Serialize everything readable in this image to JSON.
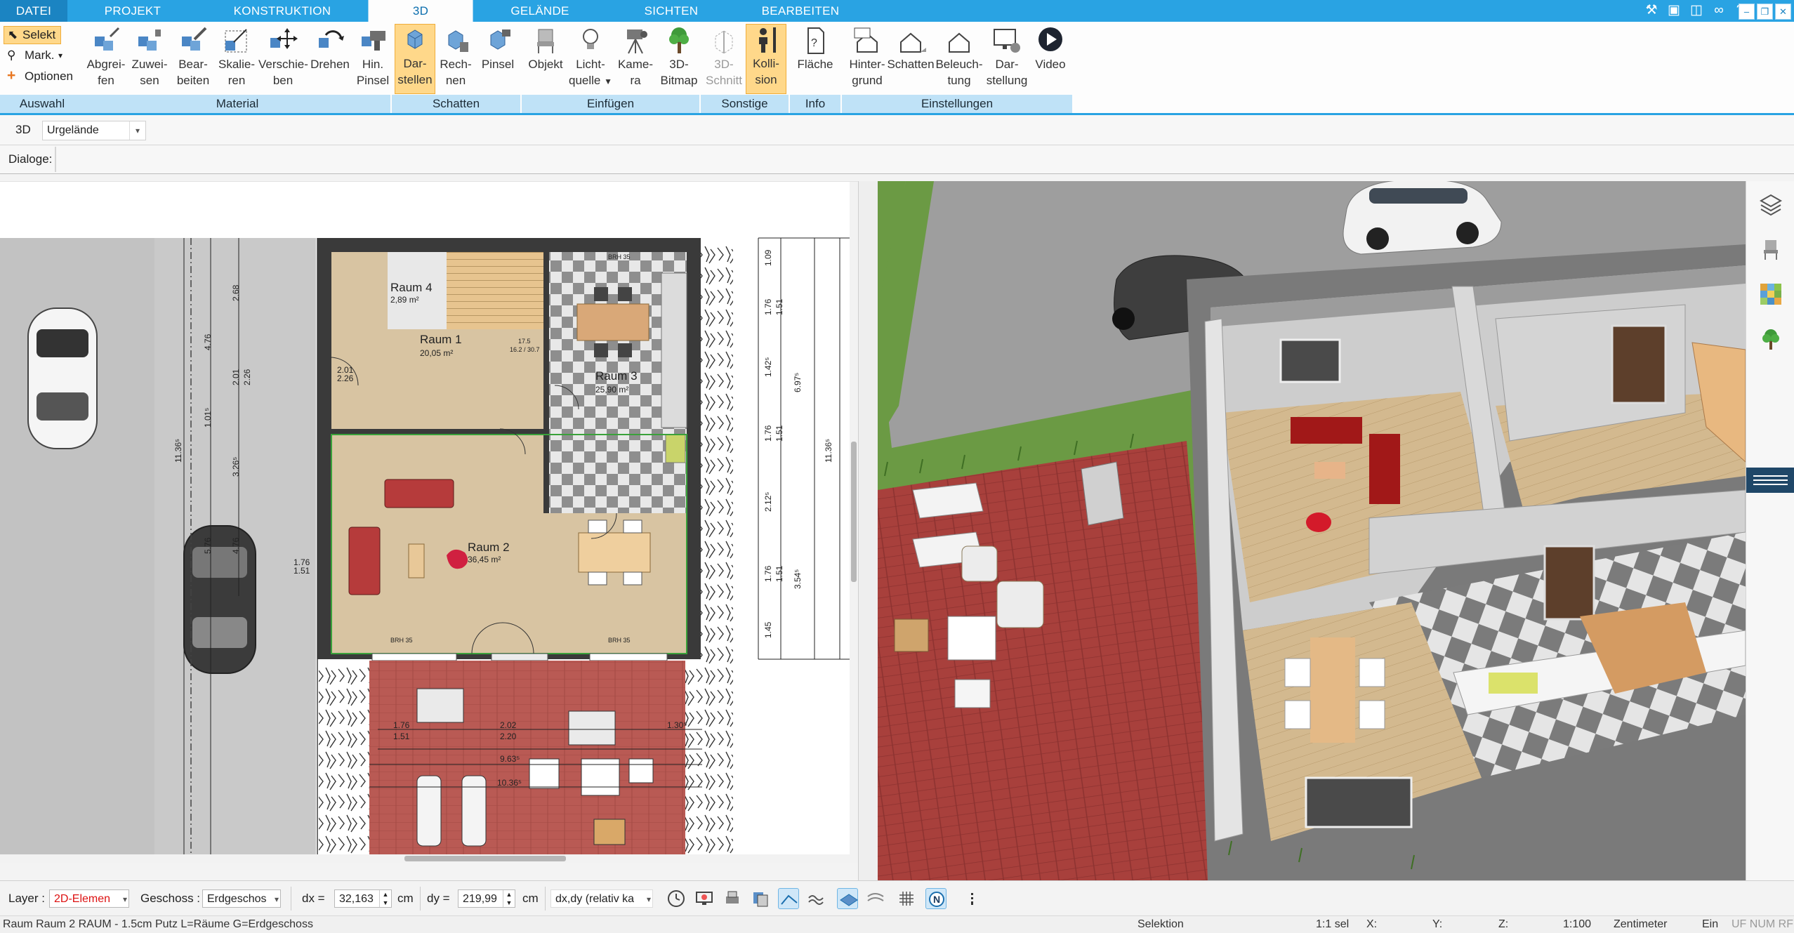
{
  "tabs": [
    "DATEI",
    "PROJEKT",
    "KONSTRUKTION",
    "3D",
    "GELÄNDE",
    "SICHTEN",
    "BEARBEITEN"
  ],
  "active_tab": "3D",
  "ribbon": {
    "auswahl": {
      "selekt": "Selekt",
      "mark": "Mark.",
      "optionen": "Optionen",
      "title": "Auswahl"
    },
    "material": {
      "buttons": [
        {
          "l1": "Abgrei-",
          "l2": "fen"
        },
        {
          "l1": "Zuwei-",
          "l2": "sen"
        },
        {
          "l1": "Bear-",
          "l2": "beiten"
        },
        {
          "l1": "Skalie-",
          "l2": "ren"
        },
        {
          "l1": "Verschie-",
          "l2": "ben"
        },
        {
          "l1": "Drehen",
          "l2": ""
        },
        {
          "l1": "Hin.",
          "l2": "Pinsel"
        }
      ],
      "title": "Material"
    },
    "schatten": {
      "buttons": [
        {
          "l1": "Dar-",
          "l2": "stellen"
        },
        {
          "l1": "Rech-",
          "l2": "nen"
        },
        {
          "l1": "Pinsel",
          "l2": ""
        }
      ],
      "title": "Schatten"
    },
    "einfuegen": {
      "buttons": [
        {
          "l1": "Objekt",
          "l2": ""
        },
        {
          "l1": "Licht-",
          "l2": "quelle"
        },
        {
          "l1": "Kame-",
          "l2": "ra"
        },
        {
          "l1": "3D-",
          "l2": "Bitmap"
        }
      ],
      "title": "Einfügen"
    },
    "sonstige": {
      "buttons": [
        {
          "l1": "3D-",
          "l2": "Schnitt"
        },
        {
          "l1": "Kolli-",
          "l2": "sion"
        }
      ],
      "title": "Sonstige"
    },
    "info": {
      "buttons": [
        {
          "l1": "Fläche",
          "l2": ""
        }
      ],
      "title": "Info"
    },
    "einstellungen": {
      "buttons": [
        {
          "l1": "Hinter-",
          "l2": "grund"
        },
        {
          "l1": "Schatten",
          "l2": ""
        },
        {
          "l1": "Beleuch-",
          "l2": "tung"
        },
        {
          "l1": "Dar-",
          "l2": "stellung"
        },
        {
          "l1": "Video",
          "l2": ""
        }
      ],
      "title": "Einstellungen"
    }
  },
  "toolbar3d": {
    "label": "3D",
    "terrain": "Urgelände"
  },
  "dialoge": {
    "label": "Dialoge:"
  },
  "plan": {
    "rooms": [
      {
        "name": "Raum 4",
        "area": "2,89 m²"
      },
      {
        "name": "Raum 1",
        "area": "20,05 m²"
      },
      {
        "name": "Raum 3",
        "area": "25,90 m²"
      },
      {
        "name": "Raum 2",
        "area": "36,45 m²"
      }
    ],
    "dims_left": [
      "2.68",
      "4.76",
      "2.01",
      "2.26",
      "3.26⁵",
      "1.01⁵",
      "11.36⁵",
      "5.76",
      "4.76",
      "1.76",
      "1.51"
    ],
    "dims_right": [
      "1.09",
      "1.76",
      "1.51",
      "1.42⁵",
      "6.97⁵",
      "1.76",
      "1.51",
      "2.12⁵",
      "1.76",
      "1.51",
      "3.54⁵",
      "1.45",
      "11.36⁵"
    ],
    "dims_bottom": [
      "1.76",
      "1.51",
      "2.02",
      "2.20",
      "1.30⁵",
      "9.63⁵",
      "10.36⁵"
    ],
    "labels": [
      "BRH 35",
      "17.5",
      "16.2 / 30.7",
      "2.01",
      "2.26",
      "1.76",
      "1.51"
    ]
  },
  "bottom": {
    "layer_label": "Layer :",
    "layer_value": "2D-Elemen",
    "geschoss_label": "Geschoss :",
    "geschoss_value": "Erdgeschos",
    "dx_label": "dx =",
    "dx_value": "32,163",
    "dx_unit": "cm",
    "dy_label": "dy =",
    "dy_value": "219,99",
    "dy_unit": "cm",
    "mode_value": "dx,dy (relativ ka"
  },
  "status": {
    "info": "Raum Raum 2 RAUM - 1.5cm Putz L=Räume G=Erdgeschoss",
    "mode": "Selektion",
    "sel": "1:1 sel",
    "x": "X:",
    "y": "Y:",
    "z": "Z:",
    "scale": "1:100",
    "unit": "Zentimeter",
    "ein": "Ein",
    "flags": "UF NUM RF"
  },
  "colors": {
    "accent": "#29a3e3",
    "accent_dark": "#1b84c2",
    "group_bg": "#bfe2f7",
    "toggle_on": "#ffd88a",
    "terrace": "#b54c47",
    "grass": "#6f9f46",
    "asphalt": "#9e9e9e"
  }
}
